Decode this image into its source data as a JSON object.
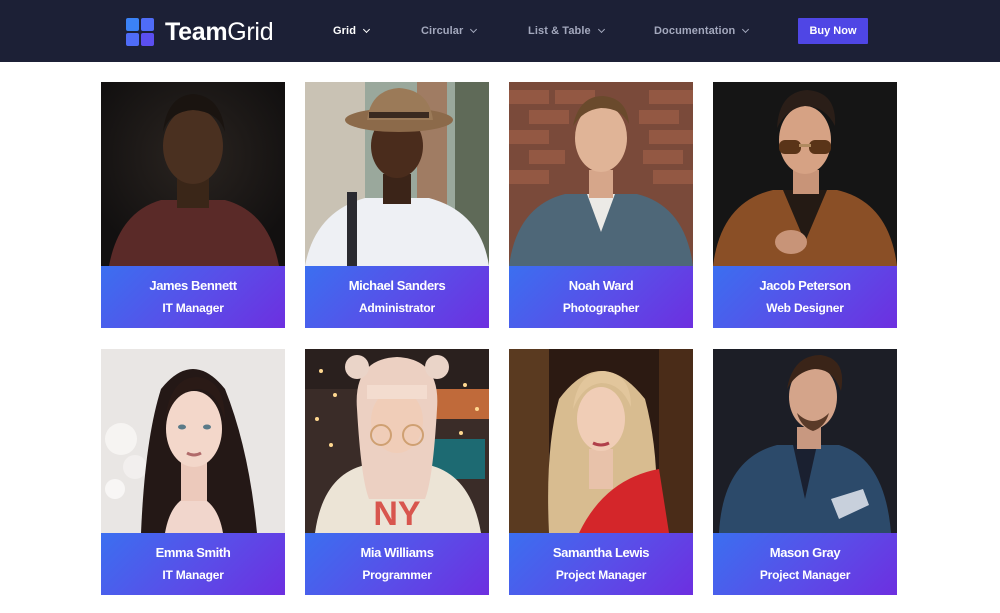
{
  "brand": {
    "name_bold": "Team",
    "name_light": "Grid"
  },
  "nav": {
    "items": [
      {
        "label": "Grid",
        "active": true
      },
      {
        "label": "Circular",
        "active": false
      },
      {
        "label": "List & Table",
        "active": false
      },
      {
        "label": "Documentation",
        "active": false
      }
    ],
    "cta_label": "Buy Now"
  },
  "colors": {
    "navbar": "#1c2036",
    "accent": "#4f46e5",
    "card_gradient_start": "#3b6ff0",
    "card_gradient_end": "#6d2fe0"
  },
  "team": [
    {
      "name": "James Bennett",
      "role": "IT Manager"
    },
    {
      "name": "Michael Sanders",
      "role": "Administrator"
    },
    {
      "name": "Noah Ward",
      "role": "Photographer"
    },
    {
      "name": "Jacob Peterson",
      "role": "Web Designer"
    },
    {
      "name": "Emma Smith",
      "role": "IT Manager"
    },
    {
      "name": "Mia Williams",
      "role": "Programmer"
    },
    {
      "name": "Samantha Lewis",
      "role": "Project Manager"
    },
    {
      "name": "Mason Gray",
      "role": "Project Manager"
    }
  ]
}
